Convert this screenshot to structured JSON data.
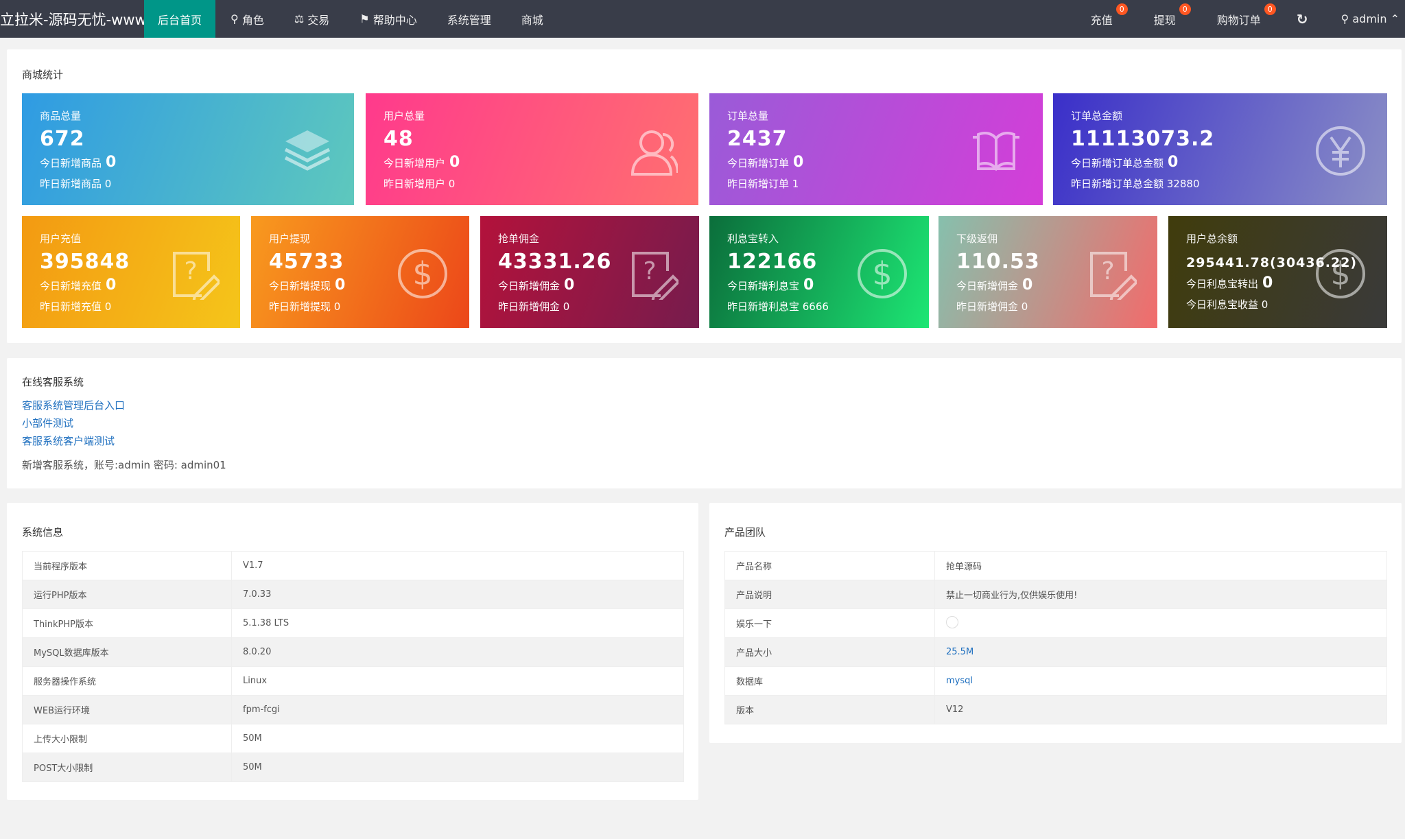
{
  "nav": {
    "brand": "立拉米-源码无忧-www...",
    "items": [
      {
        "label": "后台首页",
        "icon": "home"
      },
      {
        "label": "角色",
        "icon": "user-icon"
      },
      {
        "label": "交易",
        "icon": "scale-icon"
      },
      {
        "label": "帮助中心",
        "icon": "flag-icon"
      },
      {
        "label": "系统管理"
      },
      {
        "label": "商城"
      }
    ],
    "right": [
      {
        "label": "充值",
        "badge": "0"
      },
      {
        "label": "提现",
        "badge": "0"
      },
      {
        "label": "购物订单",
        "badge": "0"
      }
    ],
    "user": "admin",
    "active_color": "#009688"
  },
  "stats": {
    "title": "商城统计",
    "cards": [
      {
        "label": "商品总量",
        "value": "672",
        "sub_label": "今日新增商品",
        "sub_value": "0",
        "sub2": "昨日新增商品 0",
        "icon": "layers-icon"
      },
      {
        "label": "用户总量",
        "value": "48",
        "sub_label": "今日新增用户",
        "sub_value": "0",
        "sub2": "昨日新增用户 0",
        "icon": "users-icon"
      },
      {
        "label": "订单总量",
        "value": "2437",
        "sub_label": "今日新增订单",
        "sub_value": "0",
        "sub2": "昨日新增订单 1",
        "icon": "book-icon"
      },
      {
        "label": "订单总金额",
        "value": "11113073.2",
        "sub_label": "今日新增订单总金额",
        "sub_value": "0",
        "sub2": "昨日新增订单总金额 32880",
        "icon": "yen-icon"
      },
      {
        "label": "用户充值",
        "value": "395848",
        "sub_label": "今日新增充值",
        "sub_value": "0",
        "sub2": "昨日新增充值 0",
        "icon": "edit-question-icon"
      },
      {
        "label": "用户提现",
        "value": "45733",
        "sub_label": "今日新增提现",
        "sub_value": "0",
        "sub2": "昨日新增提现 0",
        "icon": "dollar-icon"
      },
      {
        "label": "抢单佣金",
        "value": "43331.26",
        "sub_label": "今日新增佣金",
        "sub_value": "0",
        "sub2": "昨日新增佣金 0",
        "icon": "edit-question-icon"
      },
      {
        "label": "利息宝转入",
        "value": "122166",
        "sub_label": "今日新增利息宝",
        "sub_value": "0",
        "sub2": "昨日新增利息宝 6666",
        "icon": "dollar-icon"
      },
      {
        "label": "下级返佣",
        "value": "110.53",
        "sub_label": "今日新增佣金",
        "sub_value": "0",
        "sub2": "昨日新增佣金 0",
        "icon": "edit-question-icon"
      },
      {
        "label": "用户总余额",
        "value": "295441.78(30436.22)",
        "sub_label": "今日利息宝转出",
        "sub_value": "0",
        "sub2": "今日利息宝收益 0",
        "icon": "dollar-icon"
      }
    ]
  },
  "service": {
    "title": "在线客服系统",
    "links": [
      "客服系统管理后台入口",
      "小部件测试",
      "客服系统客户端测试"
    ],
    "note": "新增客服系统，账号:admin 密码: admin01"
  },
  "sysinfo": {
    "title": "系统信息",
    "rows": [
      [
        "当前程序版本",
        "V1.7"
      ],
      [
        "运行PHP版本",
        "7.0.33"
      ],
      [
        "ThinkPHP版本",
        "5.1.38 LTS"
      ],
      [
        "MySQL数据库版本",
        "8.0.20"
      ],
      [
        "服务器操作系统",
        "Linux"
      ],
      [
        "WEB运行环境",
        "fpm-fcgi"
      ],
      [
        "上传大小限制",
        "50M"
      ],
      [
        "POST大小限制",
        "50M"
      ]
    ]
  },
  "team": {
    "title": "产品团队",
    "rows": [
      [
        "产品名称",
        "抢单源码"
      ],
      [
        "产品说明",
        "禁止一切商业行为,仅供娱乐使用!"
      ],
      [
        "娱乐一下",
        ""
      ],
      [
        "产品大小",
        "25.5M"
      ],
      [
        "数据库",
        "mysql"
      ],
      [
        "版本",
        "V12"
      ]
    ]
  }
}
